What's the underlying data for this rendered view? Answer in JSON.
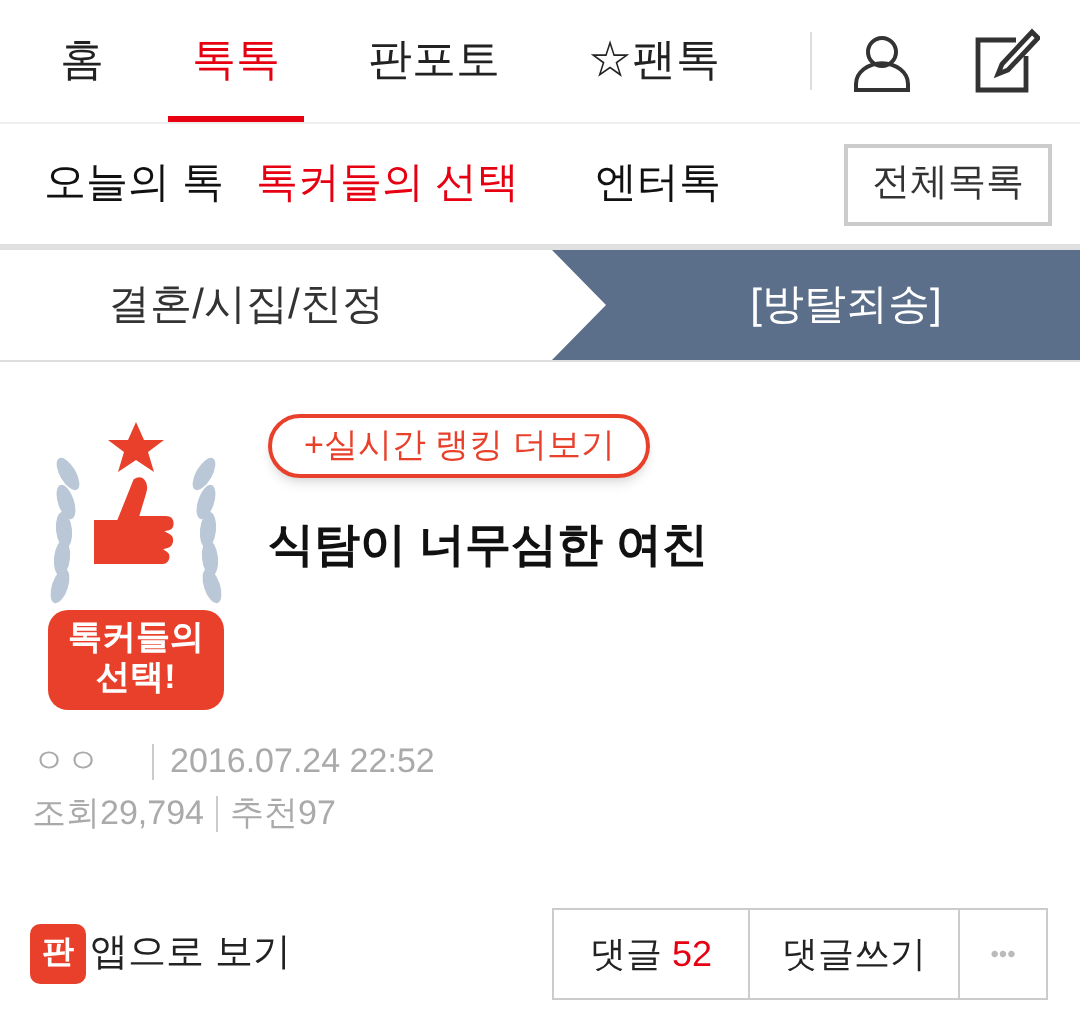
{
  "top_nav": {
    "tabs": [
      {
        "label": "홈",
        "selected": false
      },
      {
        "label": "톡톡",
        "selected": true
      },
      {
        "label": "판포토",
        "selected": false
      },
      {
        "label": "☆팬톡",
        "selected": false
      }
    ]
  },
  "sub_nav": {
    "tabs": [
      {
        "label": "오늘의 톡",
        "selected": false
      },
      {
        "label": "톡커들의 선택",
        "selected": true
      },
      {
        "label": "엔터톡",
        "selected": false
      }
    ],
    "all_button": "전체목록"
  },
  "category": [
    {
      "label": "결혼/시집/친정",
      "selected": false
    },
    {
      "label": "[방탈죄송]",
      "selected": true
    }
  ],
  "post": {
    "emblem_text": "톡커들의\n선택!",
    "ranking_link": "+실시간 랭킹 더보기",
    "title": "식탐이 너무심한 여친",
    "author": "ㅇㅇ",
    "date": "2016.07.24 22:52",
    "views": "조회29,794",
    "likes": "추천97"
  },
  "footer": {
    "app_icon_text": "판",
    "app_link": "앱으로 보기",
    "comments_label": "댓글",
    "comments_count": "52",
    "write_button": "댓글쓰기",
    "more_button": "•••"
  }
}
